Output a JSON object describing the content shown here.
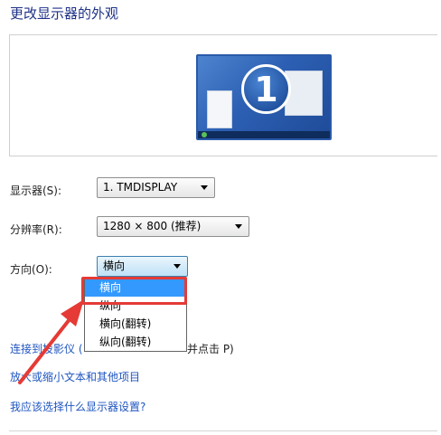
{
  "title": "更改显示器的外观",
  "preview": {
    "display_number": "1"
  },
  "display": {
    "label": "显示器(S):",
    "value": "1. TMDISPLAY"
  },
  "resolution": {
    "label": "分辨率(R):",
    "value": "1280 × 800 (推荐)"
  },
  "orientation": {
    "label": "方向(O):",
    "value": "横向",
    "options": [
      "横向",
      "纵向",
      "横向(翻转)",
      "纵向(翻转)"
    ],
    "selected_index": 0
  },
  "links": {
    "connect_projector_visible": "连接到投影仪 (",
    "connect_projector_tail": "并点击 P)",
    "enlarge_text": "放大或缩小文本和其他项目",
    "which_settings": "我应该选择什么显示器设置?"
  },
  "colors": {
    "highlight": "#e53a35",
    "link": "#1f55c0",
    "title": "#1e3287",
    "selection": "#3399ff"
  }
}
